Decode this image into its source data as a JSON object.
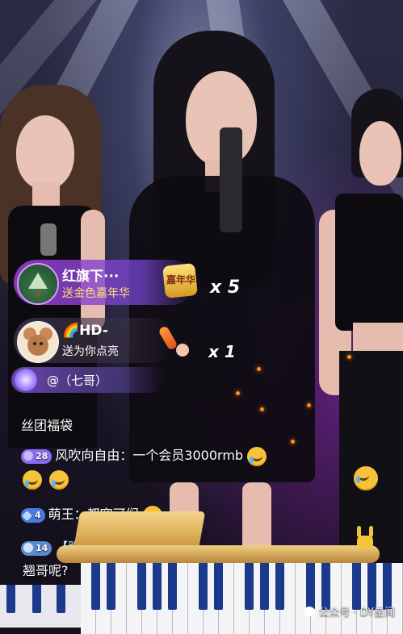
{
  "gifts": [
    {
      "user": "红旗下···",
      "action": "送金色嘉年华",
      "gift_label": "嘉年华",
      "multiplier": "x 5"
    },
    {
      "user": "🌈HD-",
      "action": "送为你点亮",
      "multiplier": "x 1"
    }
  ],
  "entrance": {
    "text": "@（七哥）"
  },
  "chat": [
    {
      "text": "丝团福袋"
    },
    {
      "level": "28",
      "level_color": "#8a6cf0",
      "text": "风吹向自由：一个会员3000rmb"
    },
    {
      "level": "4",
      "level_color": "#4a7be0",
      "text": "萌王：都突可们"
    },
    {
      "level": "14",
      "level_color": "#5a8cd0",
      "text": "【腾湖宗主】：我"
    },
    {
      "text": "翘哥呢?"
    }
  ],
  "watermark": "公众号 · DY星闻",
  "colors": {
    "gift1": "#9a3cc8",
    "ember": "#ff8a2a",
    "piano_blue": "#1c3a8c"
  }
}
